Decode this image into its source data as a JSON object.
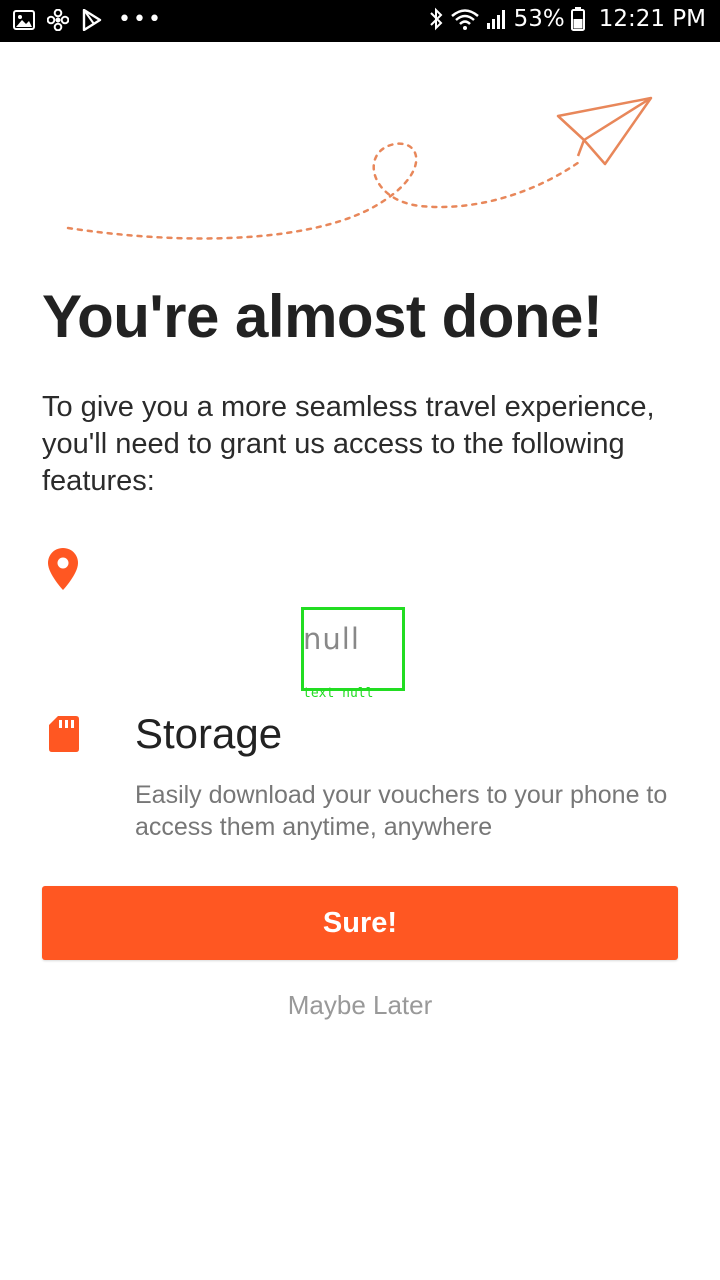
{
  "status_bar": {
    "left_icons": [
      "gallery-icon",
      "fan-icon",
      "play-store-icon",
      "more-dots-icon"
    ],
    "more_dots": "•••",
    "battery_percent": "53%",
    "time": "12:21 PM",
    "right_icons": [
      "bluetooth-icon",
      "wifi-icon",
      "signal-icon",
      "battery-icon"
    ]
  },
  "colors": {
    "accent": "#ff5722",
    "illustration": "#e8875a",
    "overlay_box": "#22dd22"
  },
  "header": {
    "title": "You're almost done!",
    "intro": "To give you a more seamless travel experience, you'll need to grant us access to the following features:"
  },
  "features": [
    {
      "icon": "location-pin-icon",
      "title": "",
      "description": ""
    },
    {
      "icon": "sd-card-icon",
      "title": "Storage",
      "description": "Easily download your vouchers to your phone to access them anytime, anywhere"
    }
  ],
  "overlay": {
    "text": "null",
    "caption": "text null"
  },
  "actions": {
    "primary_label": "Sure!",
    "secondary_label": "Maybe Later"
  }
}
